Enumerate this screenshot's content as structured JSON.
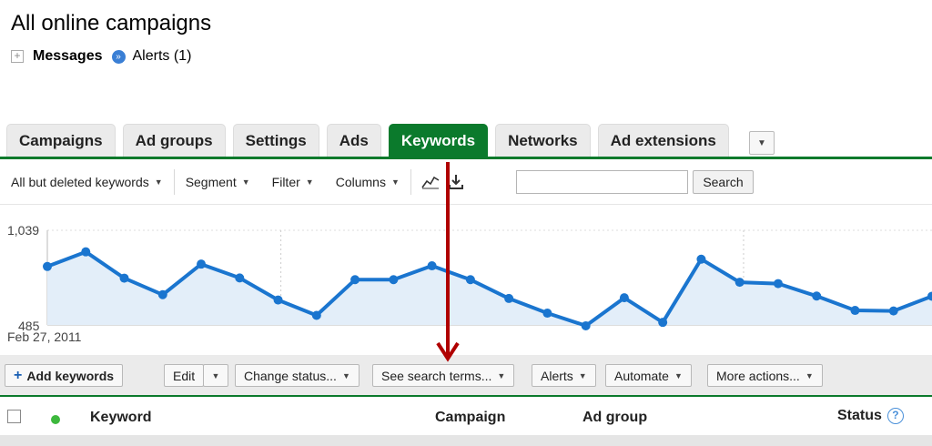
{
  "page": {
    "title": "All online campaigns"
  },
  "messages": {
    "expand_symbol": "+",
    "label": "Messages",
    "alert_icon_symbol": "»",
    "alerts": "Alerts (1)"
  },
  "tabs": [
    {
      "label": "Campaigns",
      "active": false
    },
    {
      "label": "Ad groups",
      "active": false
    },
    {
      "label": "Settings",
      "active": false
    },
    {
      "label": "Ads",
      "active": false
    },
    {
      "label": "Keywords",
      "active": true
    },
    {
      "label": "Networks",
      "active": false
    },
    {
      "label": "Ad extensions",
      "active": false
    }
  ],
  "tab_more_icon": "▼",
  "toolbar": {
    "keyword_filter": "All but deleted keywords",
    "segment": "Segment",
    "filter": "Filter",
    "columns": "Columns",
    "caret": "▼",
    "search_value": "",
    "search_button": "Search"
  },
  "chart_data": {
    "type": "area",
    "y_max_label": "1,039",
    "y_min_label": "485",
    "ylim": [
      485,
      1039
    ],
    "start_date_label": "Feb 27, 2011",
    "values": [
      827,
      913,
      759,
      662,
      841,
      760,
      631,
      541,
      750,
      750,
      831,
      750,
      640,
      554,
      480,
      644,
      500,
      870,
      735,
      727,
      654,
      570,
      567,
      653
    ],
    "grid": "dotted-vertical",
    "line_color": "#1a75cf",
    "fill_color": "#e3eef9"
  },
  "actions": {
    "add_keywords": "Add keywords",
    "add_symbol": "+",
    "edit": "Edit",
    "change_status": "Change status...",
    "see_search_terms": "See search terms...",
    "alerts": "Alerts",
    "automate": "Automate",
    "more_actions": "More actions...",
    "caret": "▼"
  },
  "table_header": {
    "keyword": "Keyword",
    "campaign": "Campaign",
    "ad_group": "Ad group",
    "status": "Status",
    "help_symbol": "?"
  },
  "colors": {
    "accent_green": "#0b7a2c",
    "annotation_arrow": "#b00000",
    "status_dot": "#3db83d"
  }
}
